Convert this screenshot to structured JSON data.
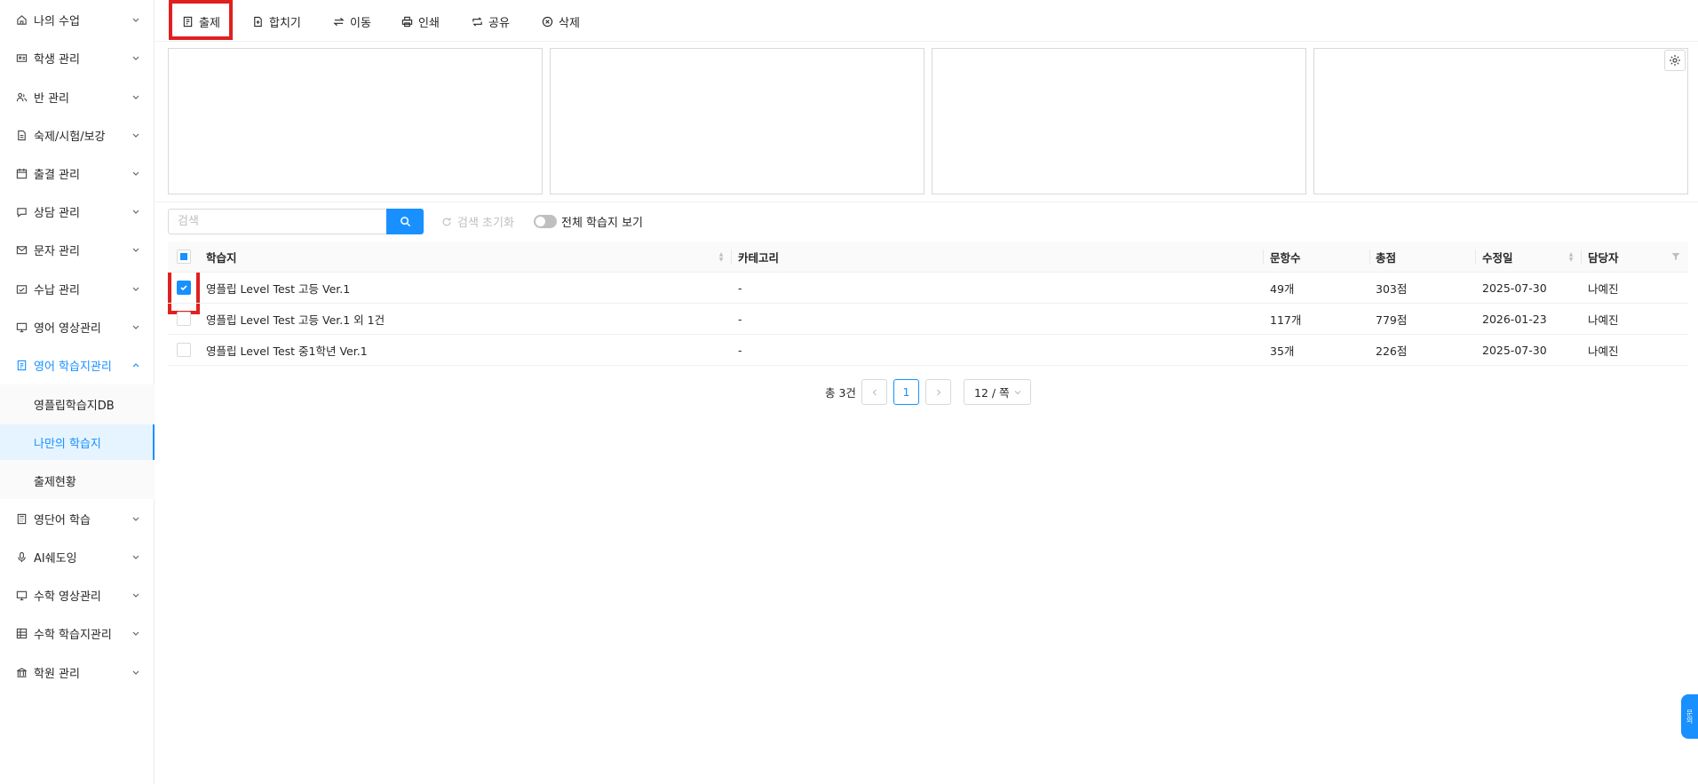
{
  "sidebar": {
    "items": [
      {
        "label": "나의 수업",
        "icon": "home-icon"
      },
      {
        "label": "학생 관리",
        "icon": "id-card-icon"
      },
      {
        "label": "반 관리",
        "icon": "users-icon"
      },
      {
        "label": "숙제/시험/보강",
        "icon": "file-icon"
      },
      {
        "label": "출결 관리",
        "icon": "calendar-icon"
      },
      {
        "label": "상담 관리",
        "icon": "chat-icon"
      },
      {
        "label": "문자 관리",
        "icon": "mail-icon"
      },
      {
        "label": "수납 관리",
        "icon": "wallet-icon"
      },
      {
        "label": "영어 영상관리",
        "icon": "monitor-icon"
      },
      {
        "label": "영어 학습지관리",
        "icon": "book-icon"
      },
      {
        "label": "영단어 학습",
        "icon": "calculator-icon"
      },
      {
        "label": "AI쉐도잉",
        "icon": "microphone-icon"
      },
      {
        "label": "수학 영상관리",
        "icon": "monitor-icon"
      },
      {
        "label": "수학 학습지관리",
        "icon": "grid-icon"
      },
      {
        "label": "학원 관리",
        "icon": "bank-icon"
      }
    ],
    "subitems": [
      {
        "label": "영플립학습지DB"
      },
      {
        "label": "나만의 학습지"
      },
      {
        "label": "출제현황"
      }
    ],
    "accent_color": "#1890ff"
  },
  "toolbar": {
    "buttons": [
      {
        "label": "출제",
        "icon": "assign-icon"
      },
      {
        "label": "합치기",
        "icon": "merge-icon"
      },
      {
        "label": "이동",
        "icon": "move-icon"
      },
      {
        "label": "인쇄",
        "icon": "print-icon"
      },
      {
        "label": "공유",
        "icon": "share-icon"
      },
      {
        "label": "삭제",
        "icon": "delete-icon"
      }
    ]
  },
  "search": {
    "placeholder": "검색",
    "reset_label": "검색 초기화",
    "toggle_label": "전체 학습지 보기",
    "toggle_on": false
  },
  "table": {
    "columns": [
      "학습지",
      "카테고리",
      "문항수",
      "총점",
      "수정일",
      "담당자"
    ],
    "rows": [
      {
        "checked": true,
        "title": "영플립 Level Test 고등 Ver.1",
        "category": "-",
        "count": "49개",
        "score": "303점",
        "date": "2025-07-30",
        "owner": "나예진"
      },
      {
        "checked": false,
        "title": "영플립 Level Test 고등 Ver.1 외 1건",
        "category": "-",
        "count": "117개",
        "score": "779점",
        "date": "2026-01-23",
        "owner": "나예진"
      },
      {
        "checked": false,
        "title": "영플립 Level Test 중1학년 Ver.1",
        "category": "-",
        "count": "35개",
        "score": "226점",
        "date": "2025-07-30",
        "owner": "나예진"
      }
    ]
  },
  "pagination": {
    "total": "총 3건",
    "current_page": "1",
    "page_size": "12 / 쪽"
  },
  "float_tab": {
    "label": "문의"
  }
}
